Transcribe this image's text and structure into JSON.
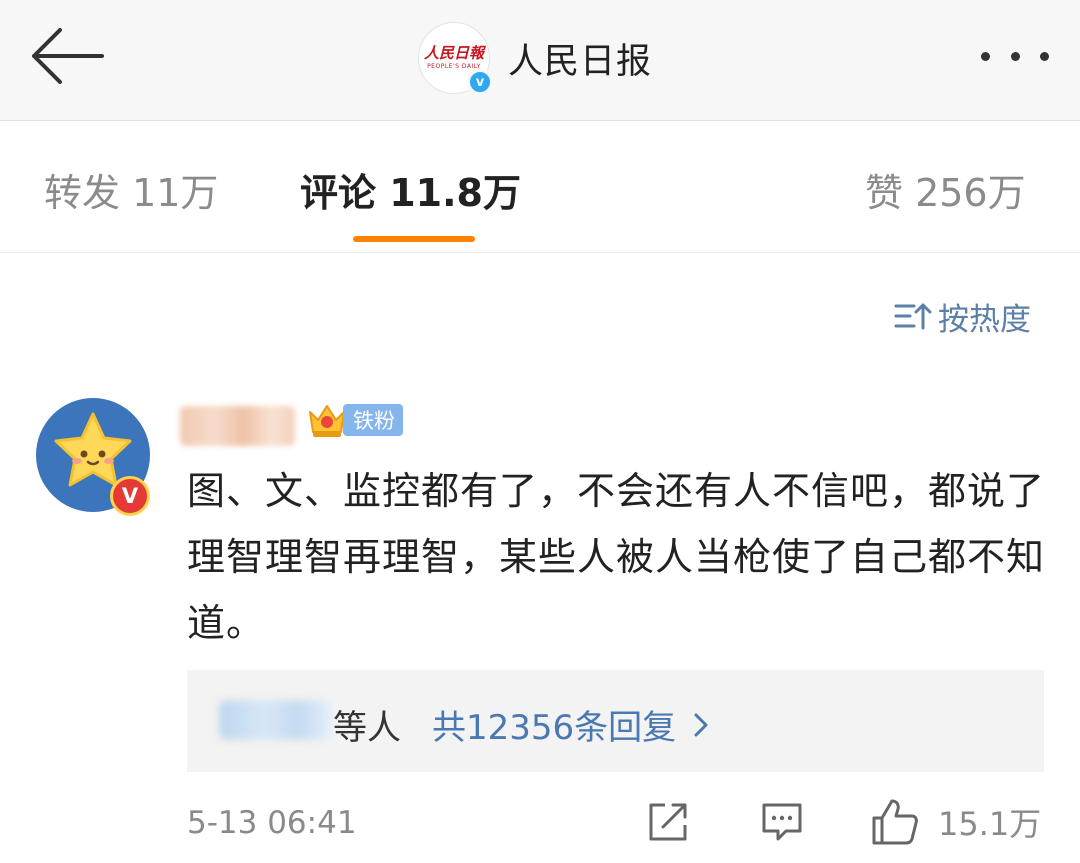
{
  "header": {
    "title": "人民日报",
    "logo_text": "人民日報",
    "logo_subtext": "PEOPLE'S DAILY",
    "verified_mark": "v"
  },
  "tabs": [
    {
      "label": "转发 11万"
    },
    {
      "label": "评论 11.8万",
      "active": true
    },
    {
      "label": "赞 256万"
    }
  ],
  "sort": {
    "label": "按热度"
  },
  "comment": {
    "badge_text": "V",
    "fan_badge": "铁粉",
    "text": "图、文、监控都有了，不会还有人不信吧，都说了理智理智再理智，某些人被人当枪使了自己都不知道。",
    "reply_suffix": "等人",
    "reply_link": "共12356条回复",
    "timestamp": "5-13 06:41",
    "like_count": "15.1万"
  },
  "colors": {
    "accent": "#ff8200",
    "link": "#4a78b0",
    "verified": "#2ea8f0",
    "fan_badge": "#84b6ec"
  },
  "icons": [
    "back-arrow-icon",
    "verified-icon",
    "more-icon",
    "sort-icon",
    "crown-icon",
    "chevron-right-icon",
    "share-icon",
    "comment-icon",
    "like-icon"
  ]
}
